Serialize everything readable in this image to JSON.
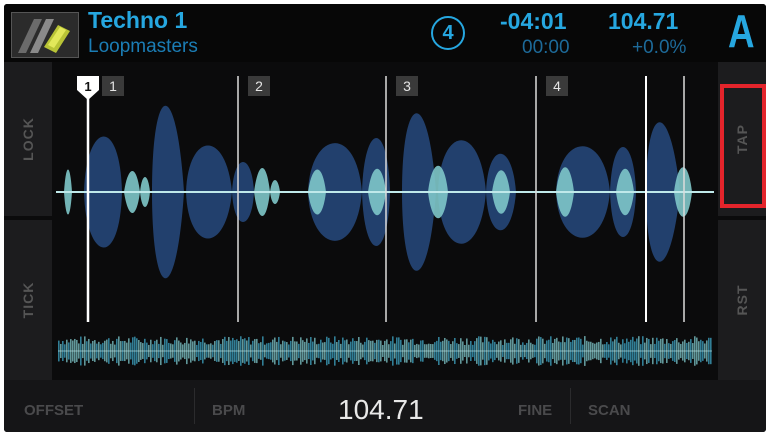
{
  "track": {
    "title": "Techno 1",
    "artist": "Loopmasters",
    "beat_counter": "4",
    "time_remaining": "-04:01",
    "time_elapsed": "00:00",
    "bpm": "104.71",
    "pitch": "+0.0%",
    "deck": "A"
  },
  "side_buttons": {
    "lock": "LOCK",
    "tick": "TICK",
    "tap": "TAP",
    "rst": "RST"
  },
  "beat_markers": {
    "cue": "1",
    "bars": [
      "1",
      "2",
      "3",
      "4"
    ]
  },
  "footer": {
    "offset": "OFFSET",
    "bpm_label": "BPM",
    "bpm_value": "104.71",
    "fine": "FINE",
    "scan": "SCAN"
  },
  "colors": {
    "accent": "#26a7e0",
    "wave_body": "#23406e",
    "wave_core": "#8fd6d8",
    "highlight": "#e3242b"
  }
}
